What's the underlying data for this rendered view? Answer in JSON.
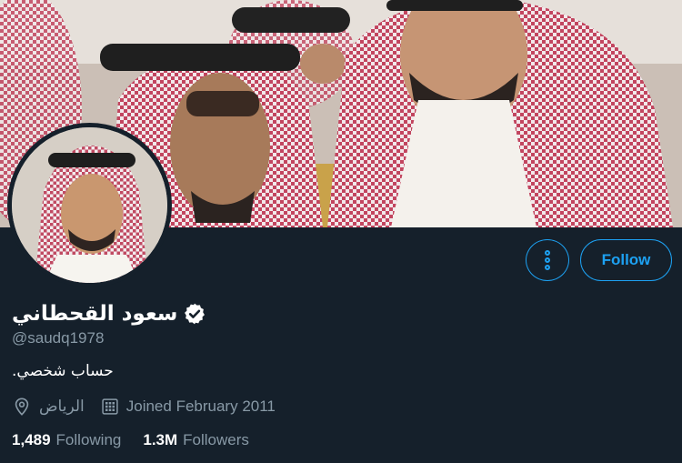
{
  "profile": {
    "display_name": "سعود القحطاني",
    "handle": "@saudq1978",
    "bio": "حساب شخصي.",
    "location": "الرياض",
    "joined": "Joined February 2011",
    "verified": true
  },
  "actions": {
    "follow_label": "Follow"
  },
  "stats": {
    "following_count": "1,489",
    "following_label": "Following",
    "followers_count": "1.3M",
    "followers_label": "Followers"
  },
  "icons": {
    "more": "more-vertical-icon",
    "verified": "verified-badge-icon",
    "location": "location-pin-icon",
    "calendar": "calendar-icon"
  },
  "colors": {
    "background": "#15202b",
    "accent": "#1da1f2",
    "secondary_text": "#8899a6",
    "primary_text": "#ffffff"
  }
}
